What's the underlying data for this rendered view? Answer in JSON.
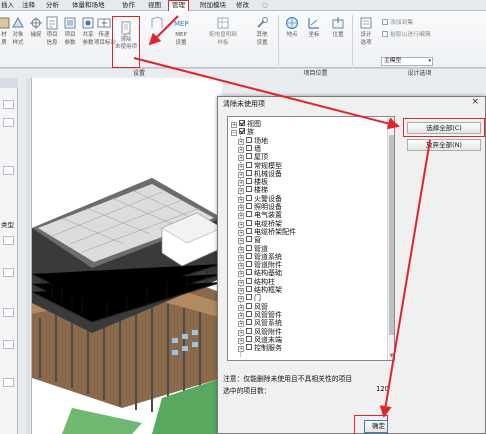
{
  "ribbon": {
    "tabs": [
      {
        "label": "插入"
      },
      {
        "label": "注释"
      },
      {
        "label": "分析"
      },
      {
        "label": "体量和场地"
      },
      {
        "label": "协作"
      },
      {
        "label": "视图"
      },
      {
        "label": "管理",
        "active": true
      },
      {
        "label": "附加模块"
      },
      {
        "label": "修改"
      }
    ],
    "buttons": [
      {
        "label1": "材",
        "label2": "质"
      },
      {
        "label1": "对象",
        "label2": "样式"
      },
      {
        "label1": "捕捉",
        "label2": ""
      },
      {
        "label1": "项目",
        "label2": "信息"
      },
      {
        "label1": "项目",
        "label2": "参数"
      },
      {
        "label1": "共享",
        "label2": "参数"
      },
      {
        "label1": "传递",
        "label2": "项目标准"
      },
      {
        "label1": "MEP",
        "label2": "设置"
      },
      {
        "label1": "配电盘明细",
        "label2": "样板"
      },
      {
        "label1": "其他",
        "label2": "设置"
      },
      {
        "label1": "地点",
        "label2": ""
      },
      {
        "label1": "坐标",
        "label2": ""
      },
      {
        "label1": "位置",
        "label2": ""
      },
      {
        "label1": "设计",
        "label2": "选项"
      }
    ],
    "purge_button": {
      "label1": "清除",
      "label2": "未使用项"
    },
    "panels": {
      "settings": "设置",
      "project_location": "项目位置",
      "design_options": "设计选项"
    },
    "design_options": {
      "add_to_set": "添加到集",
      "pick_to_edit": "拾取以进行编辑",
      "main_model": "主模型"
    },
    "quick_toggle": "○"
  },
  "palette": {
    "type_label": "类型"
  },
  "dialog": {
    "title": "清除未使用项",
    "close_glyph": "×",
    "tree": [
      {
        "label": "视图",
        "level": 0,
        "expanded": false,
        "checked": true
      },
      {
        "label": "族",
        "level": 0,
        "expanded": true,
        "checked": true
      },
      {
        "label": "场地",
        "level": 1
      },
      {
        "label": "墙",
        "level": 1
      },
      {
        "label": "屋顶",
        "level": 1
      },
      {
        "label": "常规模型",
        "level": 1
      },
      {
        "label": "机械设备",
        "level": 1
      },
      {
        "label": "楼板",
        "level": 1
      },
      {
        "label": "楼梯",
        "level": 1
      },
      {
        "label": "火警设备",
        "level": 1
      },
      {
        "label": "照明设备",
        "level": 1
      },
      {
        "label": "电气装置",
        "level": 1
      },
      {
        "label": "电缆桥架",
        "level": 1
      },
      {
        "label": "电缆桥架配件",
        "level": 1
      },
      {
        "label": "窗",
        "level": 1
      },
      {
        "label": "管道",
        "level": 1
      },
      {
        "label": "管道系统",
        "level": 1
      },
      {
        "label": "管道附件",
        "level": 1
      },
      {
        "label": "结构基础",
        "level": 1
      },
      {
        "label": "结构柱",
        "level": 1
      },
      {
        "label": "结构框架",
        "level": 1
      },
      {
        "label": "门",
        "level": 1
      },
      {
        "label": "风管",
        "level": 1
      },
      {
        "label": "风管管件",
        "level": 1
      },
      {
        "label": "风管系统",
        "level": 1
      },
      {
        "label": "风管附件",
        "level": 1
      },
      {
        "label": "风道末端",
        "level": 1
      },
      {
        "label": "控制服务",
        "level": 1
      }
    ],
    "buttons": {
      "select_all": "选择全部(C)",
      "deselect_all": "放弃全部(N)",
      "ok": "确定"
    },
    "note": "注意：仅能删除未使用且不具相关性的项目",
    "count_label": "选中的项目数：",
    "count_value": "120"
  },
  "colors": {
    "highlight": "#e0252a",
    "ribbon_active_tab": "#ffffff",
    "dialog_bg": "#f0f0f0"
  }
}
